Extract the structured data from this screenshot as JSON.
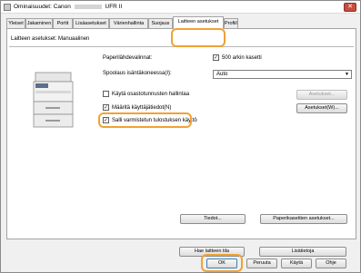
{
  "window": {
    "title_prefix": "Ominaisuudet: Canon",
    "title_suffix": "UFR II",
    "close_label": "✕"
  },
  "tabs": [
    {
      "label": "Yleiset"
    },
    {
      "label": "Jakaminen"
    },
    {
      "label": "Portit"
    },
    {
      "label": "Lisäasetukset"
    },
    {
      "label": "Värienhallinta"
    },
    {
      "label": "Suojaus"
    },
    {
      "label": "Laitteen asetukset"
    },
    {
      "label": "Profiili"
    }
  ],
  "panel": {
    "header": "Laitteen asetukset: Manuaalinen",
    "paper_source_label": "Paperilähdevalinnat:",
    "cassette_label": "500 arkin kasetti",
    "cassette_checked": "✓",
    "spooling_label": "Spoolaus isäntäkoneessa(I):",
    "spooling_value": "Auto",
    "dept_id_label": "Käytä osastotunnusten hallintaa",
    "user_info_label": "Määritä käyttäjätiedot(N)",
    "user_info_checked": "✓",
    "remote_print_label": "Salli varmistetun tulostuksen käyttö",
    "remote_print_checked": "✓",
    "settings_btn": "Asetukset...",
    "settings_w_btn": "Asetukset(W)...",
    "details_btn": "Tiedot...",
    "cassette_settings_btn": "Paperikasettien asetukset...",
    "get_status_btn": "Hae laitteen tila",
    "about_btn": "Lisätietoja"
  },
  "footer": {
    "ok": "OK",
    "cancel": "Peruuta",
    "apply": "Käytä",
    "help": "Ohje"
  },
  "colors": {
    "highlight": "#f0a234"
  }
}
